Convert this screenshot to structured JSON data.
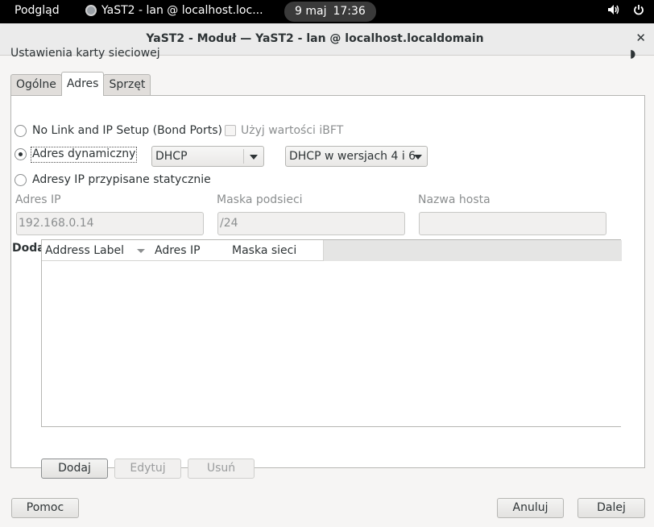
{
  "topbar": {
    "activities": "Podgląd",
    "app_title": "YaST2 - lan @ localhost.loc...",
    "date": "9 maj",
    "time": "17:36",
    "icons": [
      "volume-icon",
      "power-icon"
    ]
  },
  "window": {
    "title": "YaST2 - Moduł — YaST2 - lan @ localhost.localdomain",
    "close_glyph": "✕"
  },
  "dialog": {
    "title": "Ustawienia karty sieciowej",
    "theme_glyph": "◗"
  },
  "tabs": [
    {
      "label": "Ogólne",
      "active": false
    },
    {
      "label": "Adres",
      "active": true
    },
    {
      "label": "Sprzęt",
      "active": false
    }
  ],
  "address": {
    "option_nolink": "No Link and IP Setup (Bond Ports)",
    "ibft_label": "Użyj wartości iBFT",
    "option_dynamic": "Adres dynamiczny",
    "dynamic_type": "DHCP",
    "dhcp_version": "DHCP w wersjach 4 i 6",
    "option_static": "Adresy IP przypisane statycznie",
    "selected": "dynamic",
    "ip_label": "Adres IP",
    "ip_value": "192.168.0.14",
    "mask_label": "Maska podsieci",
    "mask_value": "/24",
    "hostname_label": "Nazwa hosta",
    "hostname_value": ""
  },
  "additional": {
    "title": "Dodatkowe adresy",
    "columns": [
      "Address Label",
      "Adres IP",
      "Maska sieci"
    ],
    "rows": [],
    "add_button": "Dodaj",
    "edit_button": "Edytuj",
    "delete_button": "Usuń"
  },
  "footer": {
    "help_button": "Pomoc",
    "cancel_button": "Anuluj",
    "next_button": "Dalej"
  },
  "colors": {
    "topbar_bg": "#000000",
    "window_bg": "#f6f5f4",
    "panel_bg": "#ffffff"
  }
}
